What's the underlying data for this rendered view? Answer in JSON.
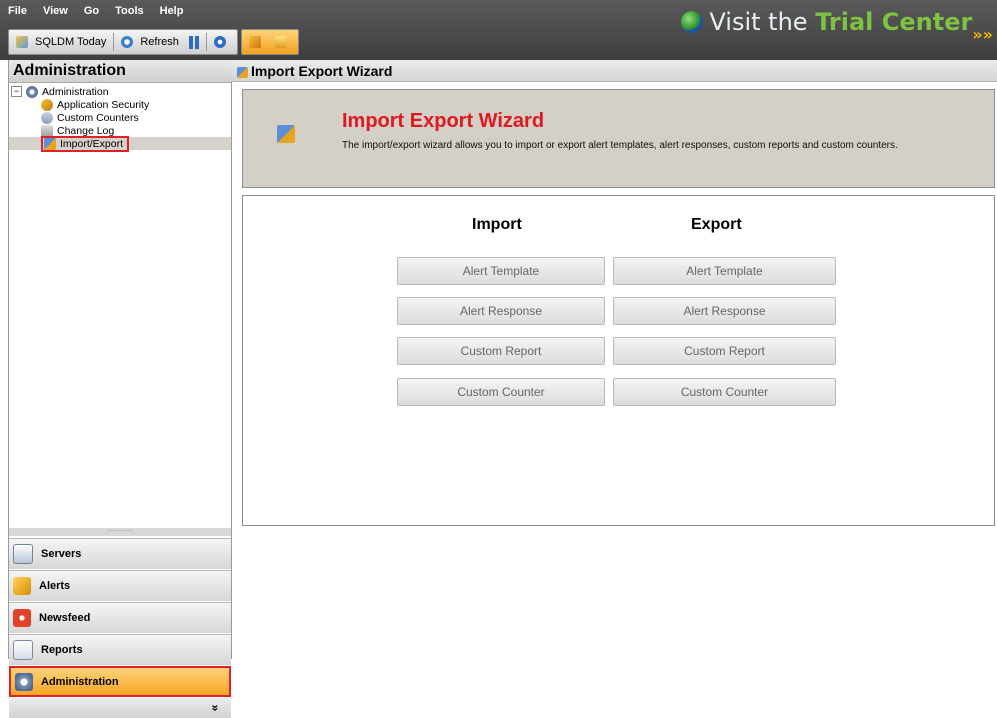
{
  "menu": [
    "File",
    "View",
    "Go",
    "Tools",
    "Help"
  ],
  "toolbar": {
    "today_label": "SQLDM Today",
    "refresh_label": "Refresh"
  },
  "trial": {
    "prefix": "Visit the ",
    "accent": "Trial Center",
    "arrows": "»»"
  },
  "left": {
    "header": "Administration",
    "tree": {
      "root": "Administration",
      "expander": "−",
      "items": [
        "Application Security",
        "Custom Counters",
        "Change Log",
        "Import/Export"
      ]
    },
    "splitter": "··········",
    "nav": [
      "Servers",
      "Alerts",
      "Newsfeed",
      "Reports",
      "Administration"
    ],
    "footer": "»"
  },
  "main": {
    "title": "Import Export Wizard",
    "wizard_title": "Import Export Wizard",
    "description": "The import/export wizard allows you to import or export alert templates, alert responses, custom reports and custom counters.",
    "import_header": "Import",
    "export_header": "Export",
    "import_buttons": [
      "Alert Template",
      "Alert Response",
      "Custom Report",
      "Custom Counter"
    ],
    "export_buttons": [
      "Alert Template",
      "Alert Response",
      "Custom Report",
      "Custom Counter"
    ]
  },
  "colors": {
    "wizard_title": "#e0181f",
    "highlight_border": "#e0202a",
    "active_nav": "#f5a623",
    "accent_green": "#7ec241"
  }
}
